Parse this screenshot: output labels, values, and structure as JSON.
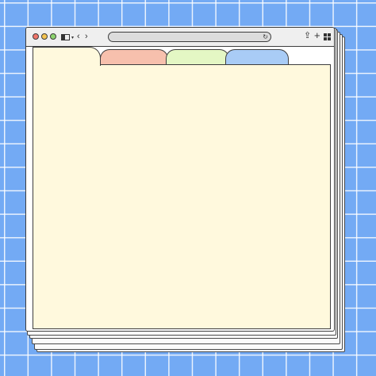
{
  "window": {
    "controls": [
      {
        "name": "close-button",
        "color": "#f0756a"
      },
      {
        "name": "minimize-button",
        "color": "#f5c451"
      },
      {
        "name": "maximize-button",
        "color": "#8cd36d"
      }
    ]
  },
  "toolbar": {
    "sidebar_icon": "sidebar-icon",
    "back_icon": "chevron-left-icon",
    "forward_icon": "chevron-right-icon",
    "reload_icon": "reload-icon",
    "share_icon": "share-icon",
    "new_tab_icon": "plus-icon",
    "tab_overview_icon": "grid-icon"
  },
  "address_bar": {
    "value": ""
  },
  "tabs": [
    {
      "name": "tab-active",
      "color": "#fff9dd"
    },
    {
      "name": "tab-red",
      "color": "#f7c0ad"
    },
    {
      "name": "tab-green",
      "color": "#e4f7c4"
    },
    {
      "name": "tab-blue",
      "color": "#a9ccf6"
    }
  ],
  "content": {
    "background": "#fff9dd"
  },
  "background": {
    "color": "#73aaf4",
    "grid": "white-lines"
  }
}
